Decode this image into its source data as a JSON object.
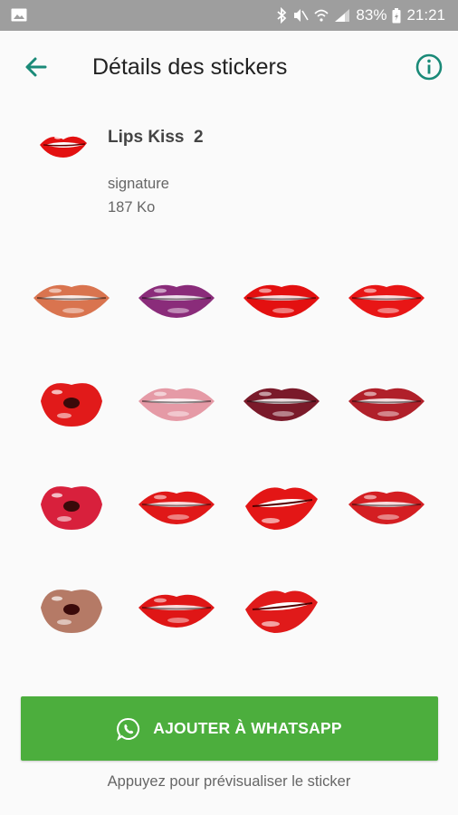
{
  "status_bar": {
    "battery": "83%",
    "time": "21:21"
  },
  "app_bar": {
    "title": "Détails des stickers"
  },
  "pack": {
    "name": "Lips Kiss  2",
    "publisher": "signature",
    "size": "187 Ko"
  },
  "stickers": [
    {
      "name": "nude-lips",
      "color": "#d9744f"
    },
    {
      "name": "purple-lips",
      "color": "#8a2c7a"
    },
    {
      "name": "red-lips",
      "color": "#e31010"
    },
    {
      "name": "red-lips",
      "color": "#e81616"
    },
    {
      "name": "red-kiss",
      "color": "#e11a1a"
    },
    {
      "name": "pink-lips",
      "color": "#e59aa6"
    },
    {
      "name": "plum-lips",
      "color": "#7a1a2a"
    },
    {
      "name": "crimson-lips",
      "color": "#b0202a"
    },
    {
      "name": "red-pout",
      "color": "#d8203c"
    },
    {
      "name": "red-lips",
      "color": "#e01818"
    },
    {
      "name": "red-bite",
      "color": "#e31616"
    },
    {
      "name": "red-lips",
      "color": "#d41e22"
    },
    {
      "name": "brown-pout",
      "color": "#b57a66"
    },
    {
      "name": "red-lips",
      "color": "#df1616"
    },
    {
      "name": "red-bite",
      "color": "#e01a1a"
    }
  ],
  "add_button": {
    "label": "AJOUTER À WHATSAPP"
  },
  "hint": "Appuyez pour prévisualiser le sticker",
  "colors": {
    "accent": "#1a8a78",
    "whatsapp_green": "#4cae3d",
    "status_bar": "#9e9e9e"
  }
}
